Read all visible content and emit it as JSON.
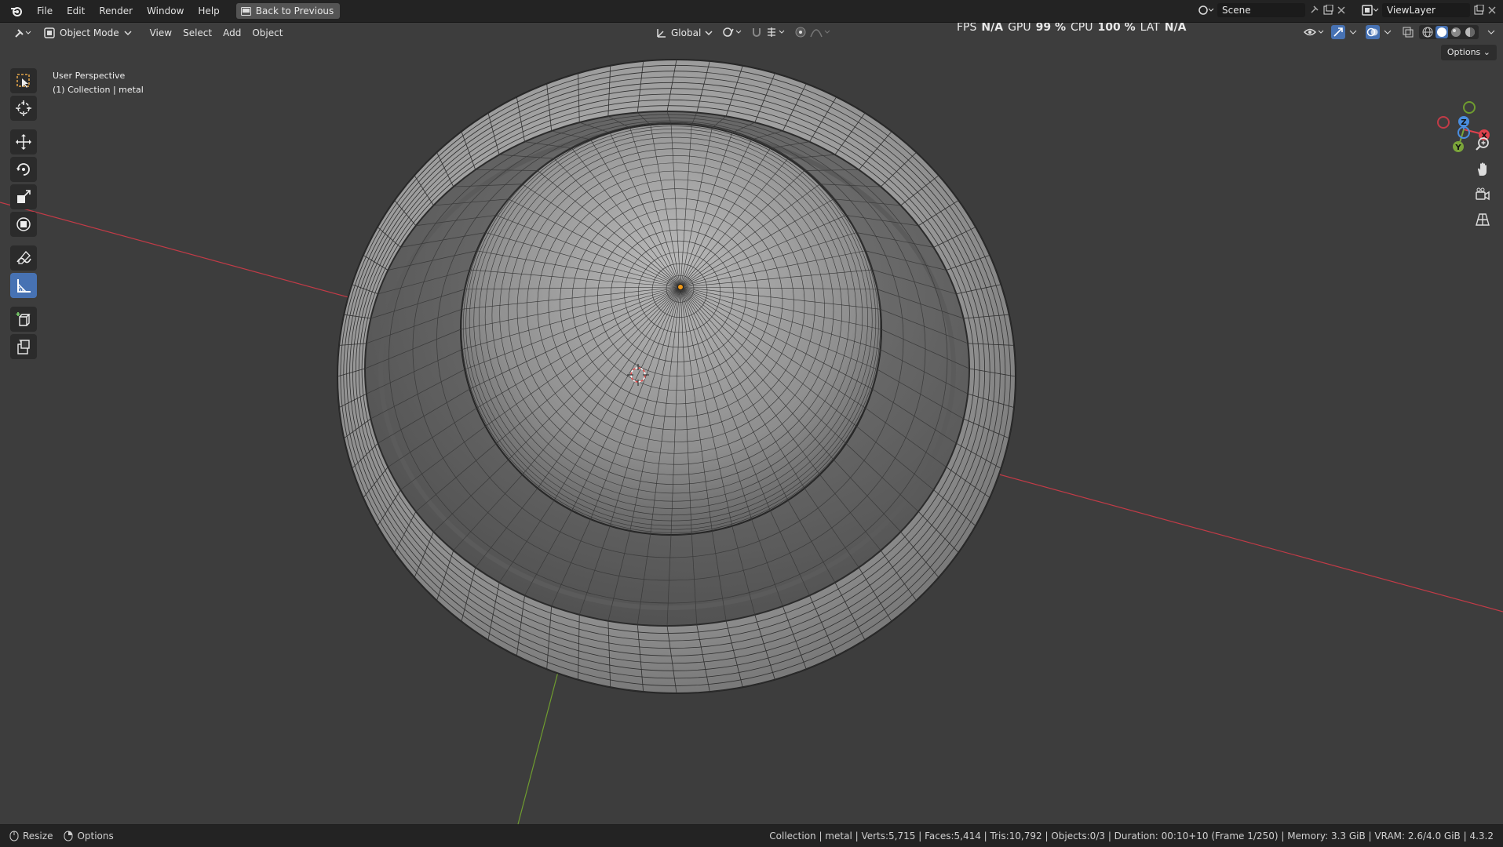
{
  "menubar": {
    "items": [
      "File",
      "Edit",
      "Render",
      "Window",
      "Help"
    ],
    "back_label": "Back to Previous",
    "scene": "Scene",
    "view_layer": "ViewLayer"
  },
  "viewport_header": {
    "mode": "Object Mode",
    "menus": [
      "View",
      "Select",
      "Add",
      "Object"
    ],
    "transform_orientation": "Global",
    "options_label": "Options"
  },
  "stats": {
    "fps_label": "FPS",
    "fps_value": "N/A",
    "gpu_label": "GPU",
    "gpu_value": "99 %",
    "cpu_label": "CPU",
    "cpu_value": "100 %",
    "lat_label": "LAT",
    "lat_value": "N/A"
  },
  "overlay": {
    "view_name": "User Perspective",
    "collection": "(1) Collection | metal"
  },
  "gizmo": {
    "x": "X",
    "y": "Y",
    "z": "Z"
  },
  "colors": {
    "x_axis": "#e0414d",
    "y_axis": "#7ba53a",
    "z_axis": "#4a8ee0",
    "active_tool": "#4772b3"
  },
  "statusbar": {
    "resize_label": "Resize",
    "options_label": "Options",
    "info": "Collection | metal | Verts:5,715 | Faces:5,414 | Tris:10,792 | Objects:0/3 | Duration: 00:10+10 (Frame 1/250) | Memory: 3.3 GiB | VRAM: 2.6/4.0 GiB | 4.3.2"
  }
}
